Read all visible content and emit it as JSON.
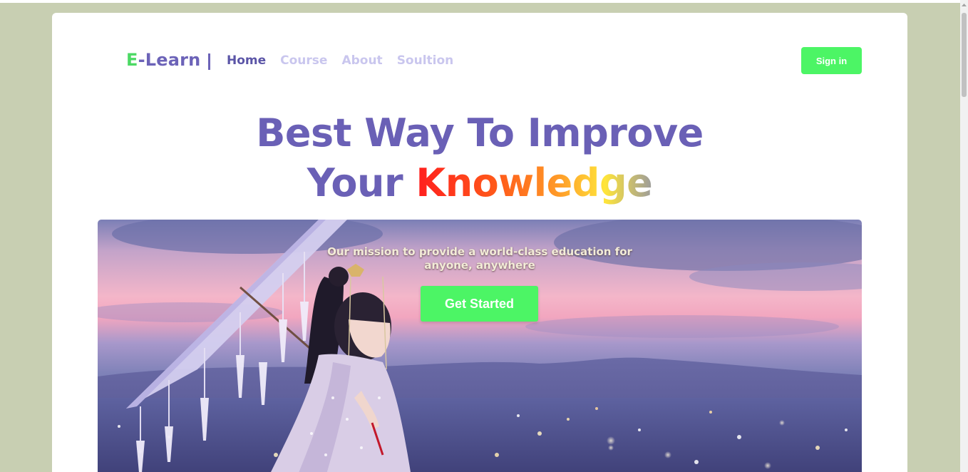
{
  "header": {
    "logo_first": "E",
    "logo_rest": "-Learn",
    "nav": [
      {
        "label": "Home",
        "active": true
      },
      {
        "label": "Course",
        "active": false
      },
      {
        "label": "About",
        "active": false
      },
      {
        "label": "Soultion",
        "active": false
      }
    ],
    "signin_label": "Sign in"
  },
  "hero": {
    "headline_line1": "Best Way To Improve",
    "headline_line2_plain": "Your",
    "headline_line2_highlight": "Knowledge",
    "mission": "Our mission to provide a world-class education for anyone, anywhere",
    "cta_label": "Get Started"
  },
  "colors": {
    "page_bg": "#c8cfb2",
    "brand_purple": "#6c63b8",
    "accent_green": "#4cf565",
    "nav_inactive": "#c9c6ee"
  },
  "icons": [
    "hero-photo-image",
    "scroll-up-arrow-icon"
  ]
}
